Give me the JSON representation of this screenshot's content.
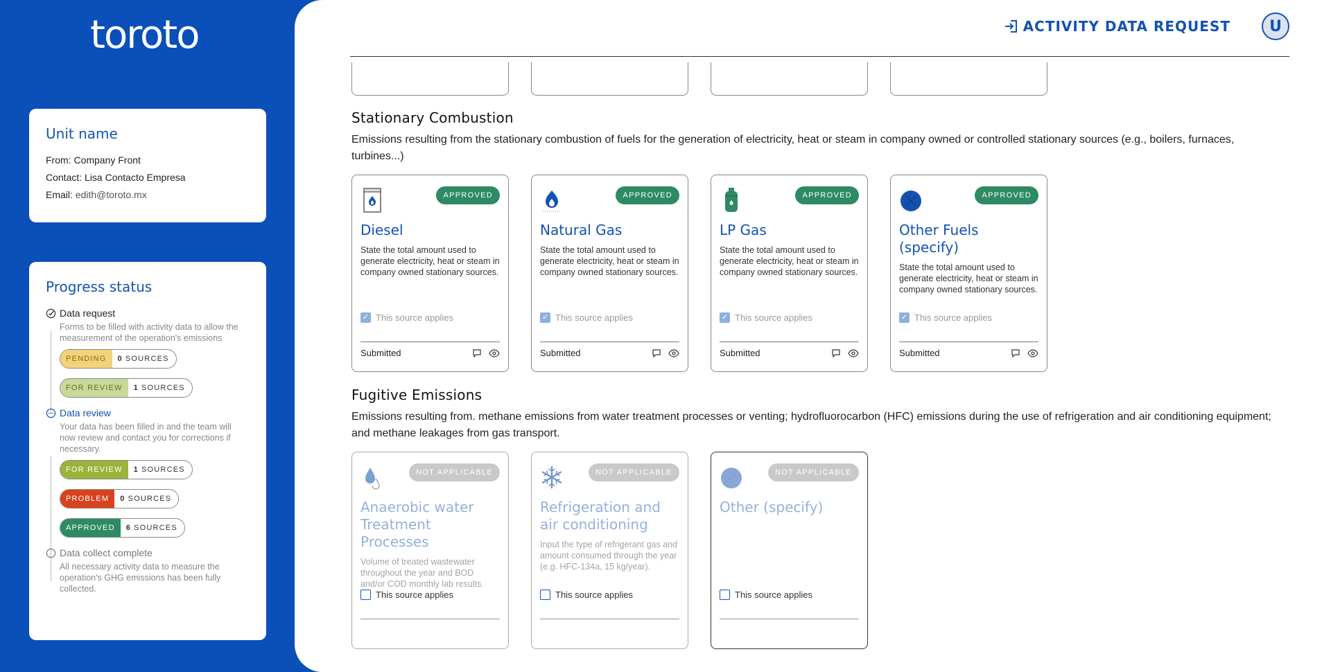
{
  "brand": {
    "logo": "toroto"
  },
  "header": {
    "action_label": "ACTIVITY DATA REQUEST",
    "avatar_initial": "U"
  },
  "unit": {
    "title": "Unit name",
    "from_label": "From:",
    "from_value": "Company Front",
    "contact_label": "Contact:",
    "contact_value": "Lisa Contacto Empresa",
    "email_label": "Email:",
    "email_value": "edith@toroto.mx"
  },
  "progress": {
    "title": "Progress status",
    "steps": [
      {
        "label": "Data request",
        "desc": "Forms to be filled with activity data to allow the measurement of the operation's emissions",
        "pills": [
          {
            "status": "PENDING",
            "count": "0",
            "unit": "SOURCES",
            "color": "#f1d37c",
            "text": "#8a6d12"
          },
          {
            "status": "FOR REVIEW",
            "count": "1",
            "unit": "SOURCES",
            "color": "#c8d99a",
            "text": "#5e7127"
          }
        ]
      },
      {
        "label": "Data review",
        "desc": "Your data has been filled in and the team will now review and contact you for corrections if necessary.",
        "pills": [
          {
            "status": "FOR REVIEW",
            "count": "1",
            "unit": "SOURCES",
            "color": "#9bb33a",
            "text": "#ffffff"
          },
          {
            "status": "PROBLEM",
            "count": "0",
            "unit": "SOURCES",
            "color": "#d8421c",
            "text": "#ffffff"
          },
          {
            "status": "APPROVED",
            "count": "6",
            "unit": "SOURCES",
            "color": "#2e8a63",
            "text": "#ffffff"
          }
        ]
      },
      {
        "label": "Data collect complete",
        "desc": "All necessary activity data to measure the operation's GHG emissions has been fully collected."
      }
    ]
  },
  "sections": {
    "stationary": {
      "title": "Stationary Combustion",
      "desc": "Emissions resulting from the stationary combustion of fuels for the generation of electricity, heat or steam in company owned or controlled stationary sources (e.g., boilers, furnaces, turbines...)",
      "cards": [
        {
          "icon": "diesel-icon",
          "badge": "APPROVED",
          "title": "Diesel",
          "desc": "State the total amount used to generate electricity, heat or steam in company owned stationary sources.",
          "applies": "This source applies",
          "status": "Submitted"
        },
        {
          "icon": "flame-icon",
          "badge": "APPROVED",
          "title": "Natural Gas",
          "desc": "State the total amount used to generate electricity, heat or steam in company owned stationary sources.",
          "applies": "This source applies",
          "status": "Submitted"
        },
        {
          "icon": "gas-cylinder-icon",
          "badge": "APPROVED",
          "title": "LP Gas",
          "desc": "State the total amount used to generate electricity, heat or steam in company owned stationary sources.",
          "applies": "This source applies",
          "status": "Submitted"
        },
        {
          "icon": "other-fuel-icon",
          "badge": "APPROVED",
          "title": "Other Fuels (specify)",
          "desc": "State the total amount used to generate electricity, heat or steam in company owned stationary sources.",
          "applies": "This source applies",
          "status": "Submitted"
        }
      ]
    },
    "fugitive": {
      "title": "Fugitive Emissions",
      "desc": "Emissions resulting from. methane emissions from water treatment processes or venting; hydrofluorocarbon (HFC) emissions during the use of refrigeration and air conditioning equipment; and methane leakages from gas transport.",
      "cards": [
        {
          "icon": "water-drop-icon",
          "badge": "NOT APPLICABLE",
          "title": "Anaerobic water Treatment Processes",
          "desc": "Volume of treated wastewater throughout the year and BOD and/or COD monthly lab results.",
          "applies": "This source applies"
        },
        {
          "icon": "snowflake-icon",
          "badge": "NOT APPLICABLE",
          "title": "Refrigeration and air conditioning",
          "desc": "Input the type of refrigerant gas and amount consumed through the year (e.g. HFC-134a, 15 kg/year).",
          "applies": "This source applies"
        },
        {
          "icon": "other-icon",
          "badge": "NOT APPLICABLE",
          "title": "Other (specify)",
          "desc": "",
          "applies": "This source applies"
        }
      ]
    }
  }
}
